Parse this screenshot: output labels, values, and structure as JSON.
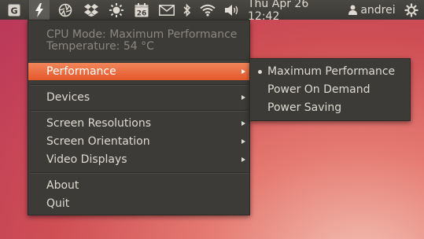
{
  "panel": {
    "indicators": [
      {
        "name": "g-app-icon",
        "glyph": "G"
      },
      {
        "name": "lightning-icon",
        "glyph": "⚡"
      },
      {
        "name": "aperture-icon",
        "glyph": "✺"
      },
      {
        "name": "dropbox-icon",
        "glyph": "❖"
      },
      {
        "name": "gear-sun-icon",
        "glyph": "✹"
      },
      {
        "name": "calendar-icon",
        "glyph": "26"
      },
      {
        "name": "mail-icon",
        "glyph": "✉"
      },
      {
        "name": "bluetooth-icon",
        "glyph": "ᛒ"
      },
      {
        "name": "wifi-icon",
        "glyph": "wifi"
      },
      {
        "name": "volume-icon",
        "glyph": "🔊"
      }
    ],
    "clock": "Thu Apr 26 12:42",
    "user": "andrei",
    "power_icon": "power-icon"
  },
  "menu": {
    "status_cpu": "CPU Mode: Maximum Performance",
    "status_temp": "Temperature: 54 °C",
    "items": {
      "performance": "Performance",
      "devices": "Devices",
      "screen_resolutions": "Screen Resolutions",
      "screen_orientation": "Screen Orientation",
      "video_displays": "Video Displays",
      "about": "About",
      "quit": "Quit"
    }
  },
  "submenu": {
    "items": [
      "Maximum Performance",
      "Power On Demand",
      "Power Saving"
    ],
    "selected_index": 0
  },
  "colors": {
    "highlight": "#e5592b",
    "menu_bg": "#3c3b37",
    "panel_bg": "#3c3b37"
  }
}
